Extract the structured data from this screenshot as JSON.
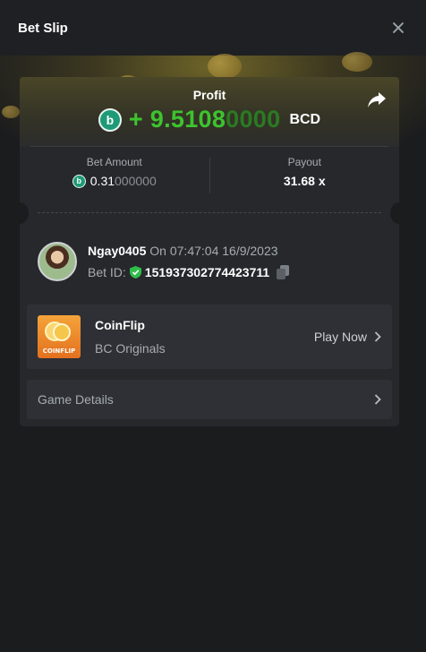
{
  "modal": {
    "title": "Bet Slip"
  },
  "profit": {
    "label": "Profit",
    "sign": "+",
    "value_main": "9.5108",
    "value_trail": "0000",
    "currency": "BCD"
  },
  "stats": {
    "bet_amount_label": "Bet Amount",
    "bet_amount_main": "0.31",
    "bet_amount_trail": "000000",
    "payout_label": "Payout",
    "payout_value": "31.68 x"
  },
  "user": {
    "name": "Ngay0405",
    "on_prefix": "On",
    "datetime": "07:47:04 16/9/2023",
    "bet_id_label": "Bet ID:",
    "bet_id": "151937302774423711"
  },
  "game": {
    "name": "CoinFlip",
    "provider": "BC Originals",
    "play_label": "Play Now",
    "thumb_label": "COINFLIP"
  },
  "details": {
    "label": "Game Details"
  },
  "colors": {
    "profit_green": "#3dc42e",
    "bcd_icon": "#1e9a76",
    "card_bg": "#26282c",
    "modal_bg": "#1b1c1e"
  },
  "icons": {
    "close": "close-icon",
    "share": "share-icon",
    "coin": "bcd-coin-icon",
    "verified": "shield-check-icon",
    "copy": "copy-icon",
    "chevron": "chevron-right-icon"
  }
}
